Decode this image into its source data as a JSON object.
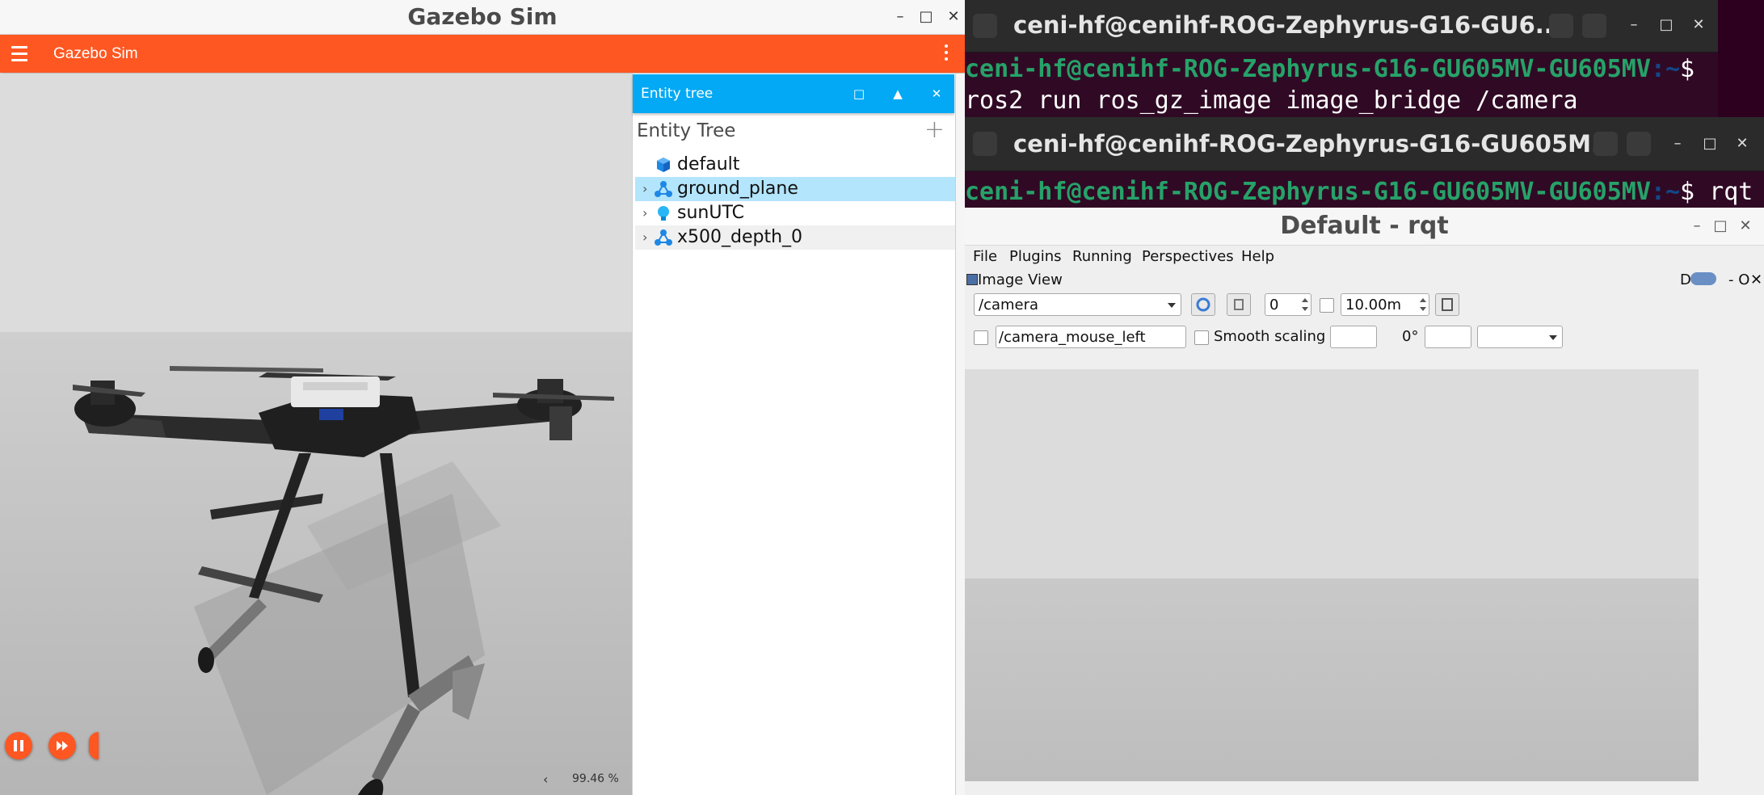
{
  "gazebo": {
    "window_title": "Gazebo Sim",
    "app_title": "Gazebo Sim",
    "rtf": "99.46 %",
    "entity_panel": {
      "header": "Entity tree",
      "heading": "Entity Tree",
      "items": [
        {
          "label": "default",
          "icon": "cube-icon",
          "expandable": false
        },
        {
          "label": "ground_plane",
          "icon": "model-icon",
          "expandable": true,
          "selected": true
        },
        {
          "label": "sunUTC",
          "icon": "light-bulb-icon",
          "expandable": true
        },
        {
          "label": "x500_depth_0",
          "icon": "model-icon",
          "expandable": true
        }
      ]
    },
    "colors": {
      "accent": "#ff5722",
      "panel_header": "#03a9f4",
      "selected_row": "#b3e5fc"
    }
  },
  "terminal1": {
    "title": "ceni-hf@cenihf-ROG-Zephyrus-G16-GU6...",
    "prompt_user": "ceni-hf@cenihf-ROG-Zephyrus-G16-GU605MV-GU605MV",
    "prompt_path": ":~",
    "prompt_symbol": "$",
    "command": "ros2 run ros_gz_image image_bridge /camera"
  },
  "terminal2": {
    "title": "ceni-hf@cenihf-ROG-Zephyrus-G16-GU605M...",
    "prompt_user": "ceni-hf@cenihf-ROG-Zephyrus-G16-GU605MV-GU605MV",
    "prompt_path": ":~",
    "prompt_symbol": "$",
    "command": " rqt"
  },
  "rqt": {
    "window_title": "Default - rqt",
    "menu": [
      "File",
      "Plugins",
      "Running",
      "Perspectives",
      "Help"
    ],
    "plugin_title": "Image View",
    "plugin_controls": "D",
    "plugin_controls_right": "- O",
    "topic": "/camera",
    "spin_value": "0",
    "max_range": "10.00m",
    "mouse_topic": "/camera_mouse_left",
    "smooth_scaling_label": "Smooth scaling",
    "rotation": "0°"
  }
}
